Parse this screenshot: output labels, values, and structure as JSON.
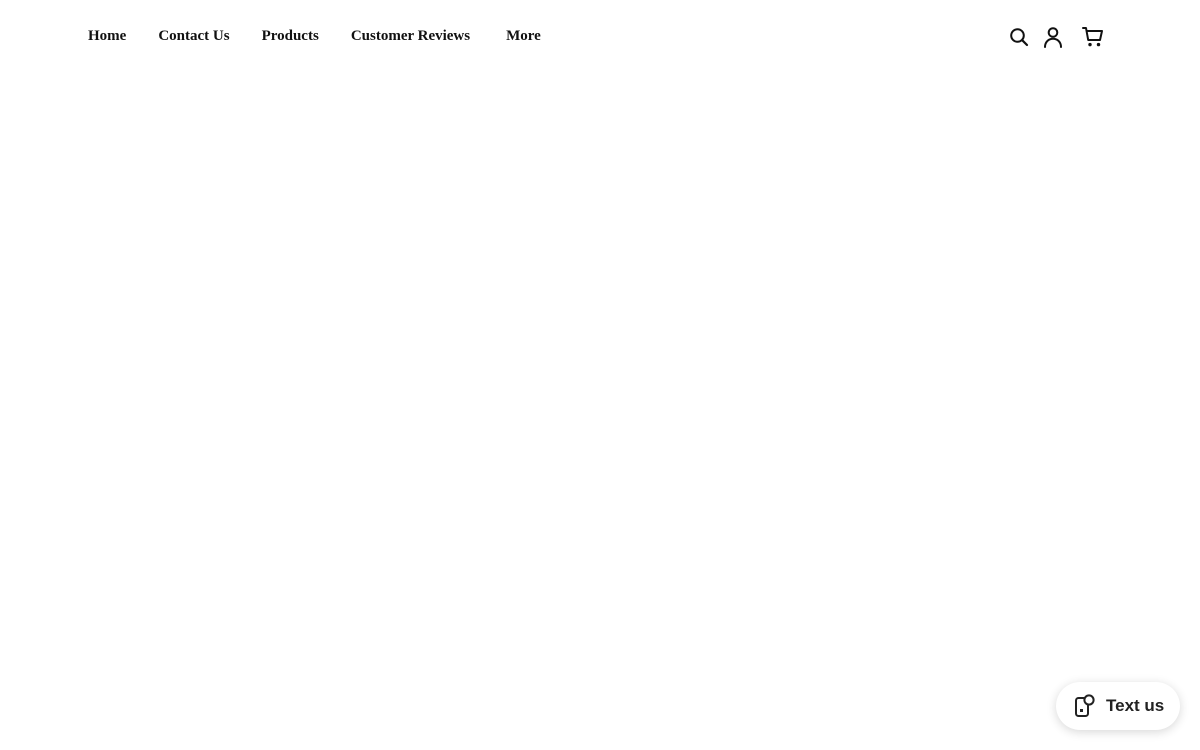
{
  "nav": {
    "items": [
      {
        "label": "Home"
      },
      {
        "label": "Contact Us"
      },
      {
        "label": "Products"
      },
      {
        "label": "Customer Reviews"
      },
      {
        "label": "More"
      }
    ]
  },
  "header_icons": [
    "search-icon",
    "account-icon",
    "cart-icon"
  ],
  "chat_widget": {
    "label": "Text us",
    "icon": "chat-phone-icon"
  },
  "colors": {
    "background": "#ffffff",
    "text": "#111111"
  }
}
